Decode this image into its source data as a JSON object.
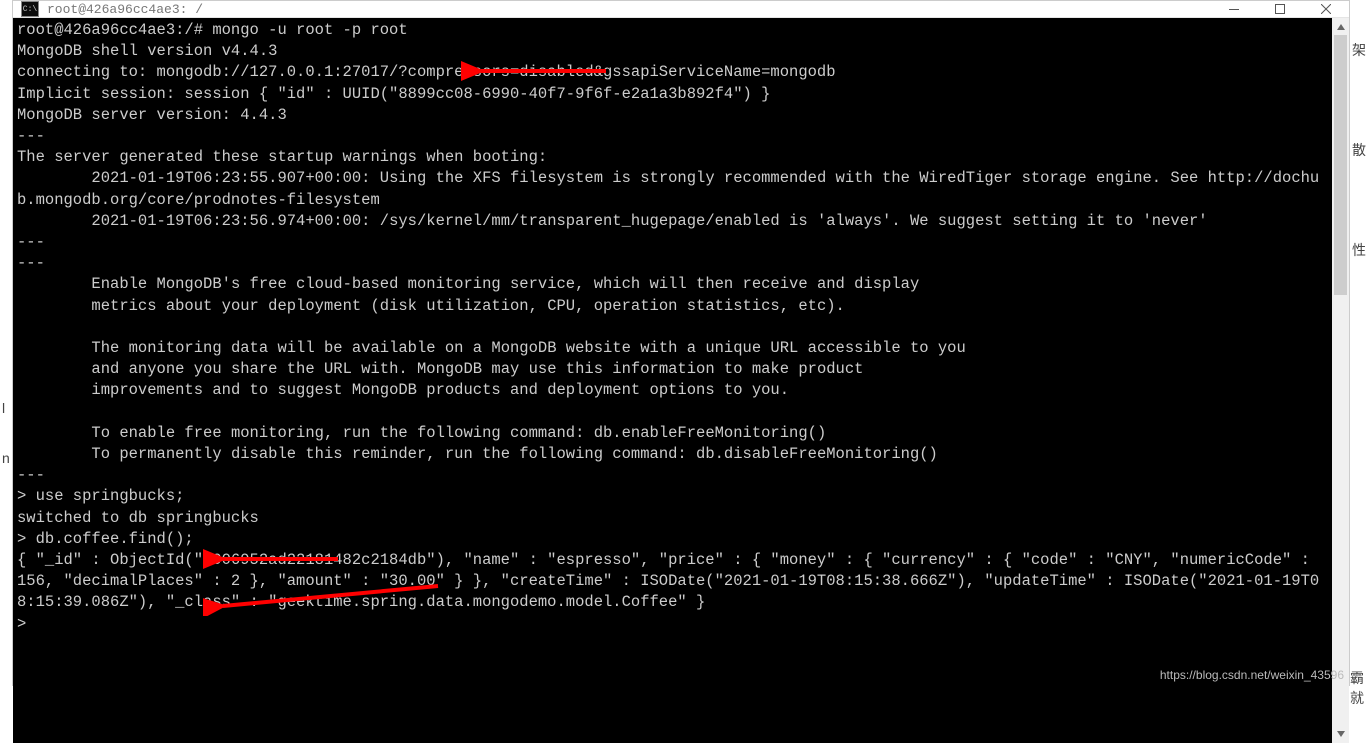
{
  "window": {
    "title": "root@426a96cc4ae3: /",
    "icon_label": "C:\\"
  },
  "terminal": {
    "lines": [
      "root@426a96cc4ae3:/# mongo -u root -p root",
      "MongoDB shell version v4.4.3",
      "connecting to: mongodb://127.0.0.1:27017/?compressors=disabled&gssapiServiceName=mongodb",
      "Implicit session: session { \"id\" : UUID(\"8899cc08-6990-40f7-9f6f-e2a1a3b892f4\") }",
      "MongoDB server version: 4.4.3",
      "---",
      "The server generated these startup warnings when booting:",
      "        2021-01-19T06:23:55.907+00:00: Using the XFS filesystem is strongly recommended with the WiredTiger storage engine. See http://dochub.mongodb.org/core/prodnotes-filesystem",
      "        2021-01-19T06:23:56.974+00:00: /sys/kernel/mm/transparent_hugepage/enabled is 'always'. We suggest setting it to 'never'",
      "---",
      "---",
      "        Enable MongoDB's free cloud-based monitoring service, which will then receive and display",
      "        metrics about your deployment (disk utilization, CPU, operation statistics, etc).",
      "",
      "        The monitoring data will be available on a MongoDB website with a unique URL accessible to you",
      "        and anyone you share the URL with. MongoDB may use this information to make product",
      "        improvements and to suggest MongoDB products and deployment options to you.",
      "",
      "        To enable free monitoring, run the following command: db.enableFreeMonitoring()",
      "        To permanently disable this reminder, run the following command: db.disableFreeMonitoring()",
      "---",
      "> use springbucks;",
      "switched to db springbucks",
      "> db.coffee.find();",
      "{ \"_id\" : ObjectId(\"6006952ad22181482c2184db\"), \"name\" : \"espresso\", \"price\" : { \"money\" : { \"currency\" : { \"code\" : \"CNY\", \"numericCode\" : 156, \"decimalPlaces\" : 2 }, \"amount\" : \"30.00\" } }, \"createTime\" : ISODate(\"2021-01-19T08:15:38.666Z\"), \"updateTime\" : ISODate(\"2021-01-19T08:15:39.086Z\"), \"_class\" : \"geektime.spring.data.mongodemo.model.Coffee\" }",
      ">"
    ]
  },
  "watermark": "https://blog.csdn.net/weixin_43596",
  "side_glyphs": [
    "架",
    "散",
    "性",
    "l",
    "n",
    "霸就"
  ],
  "arrow_color": "#ff0000"
}
